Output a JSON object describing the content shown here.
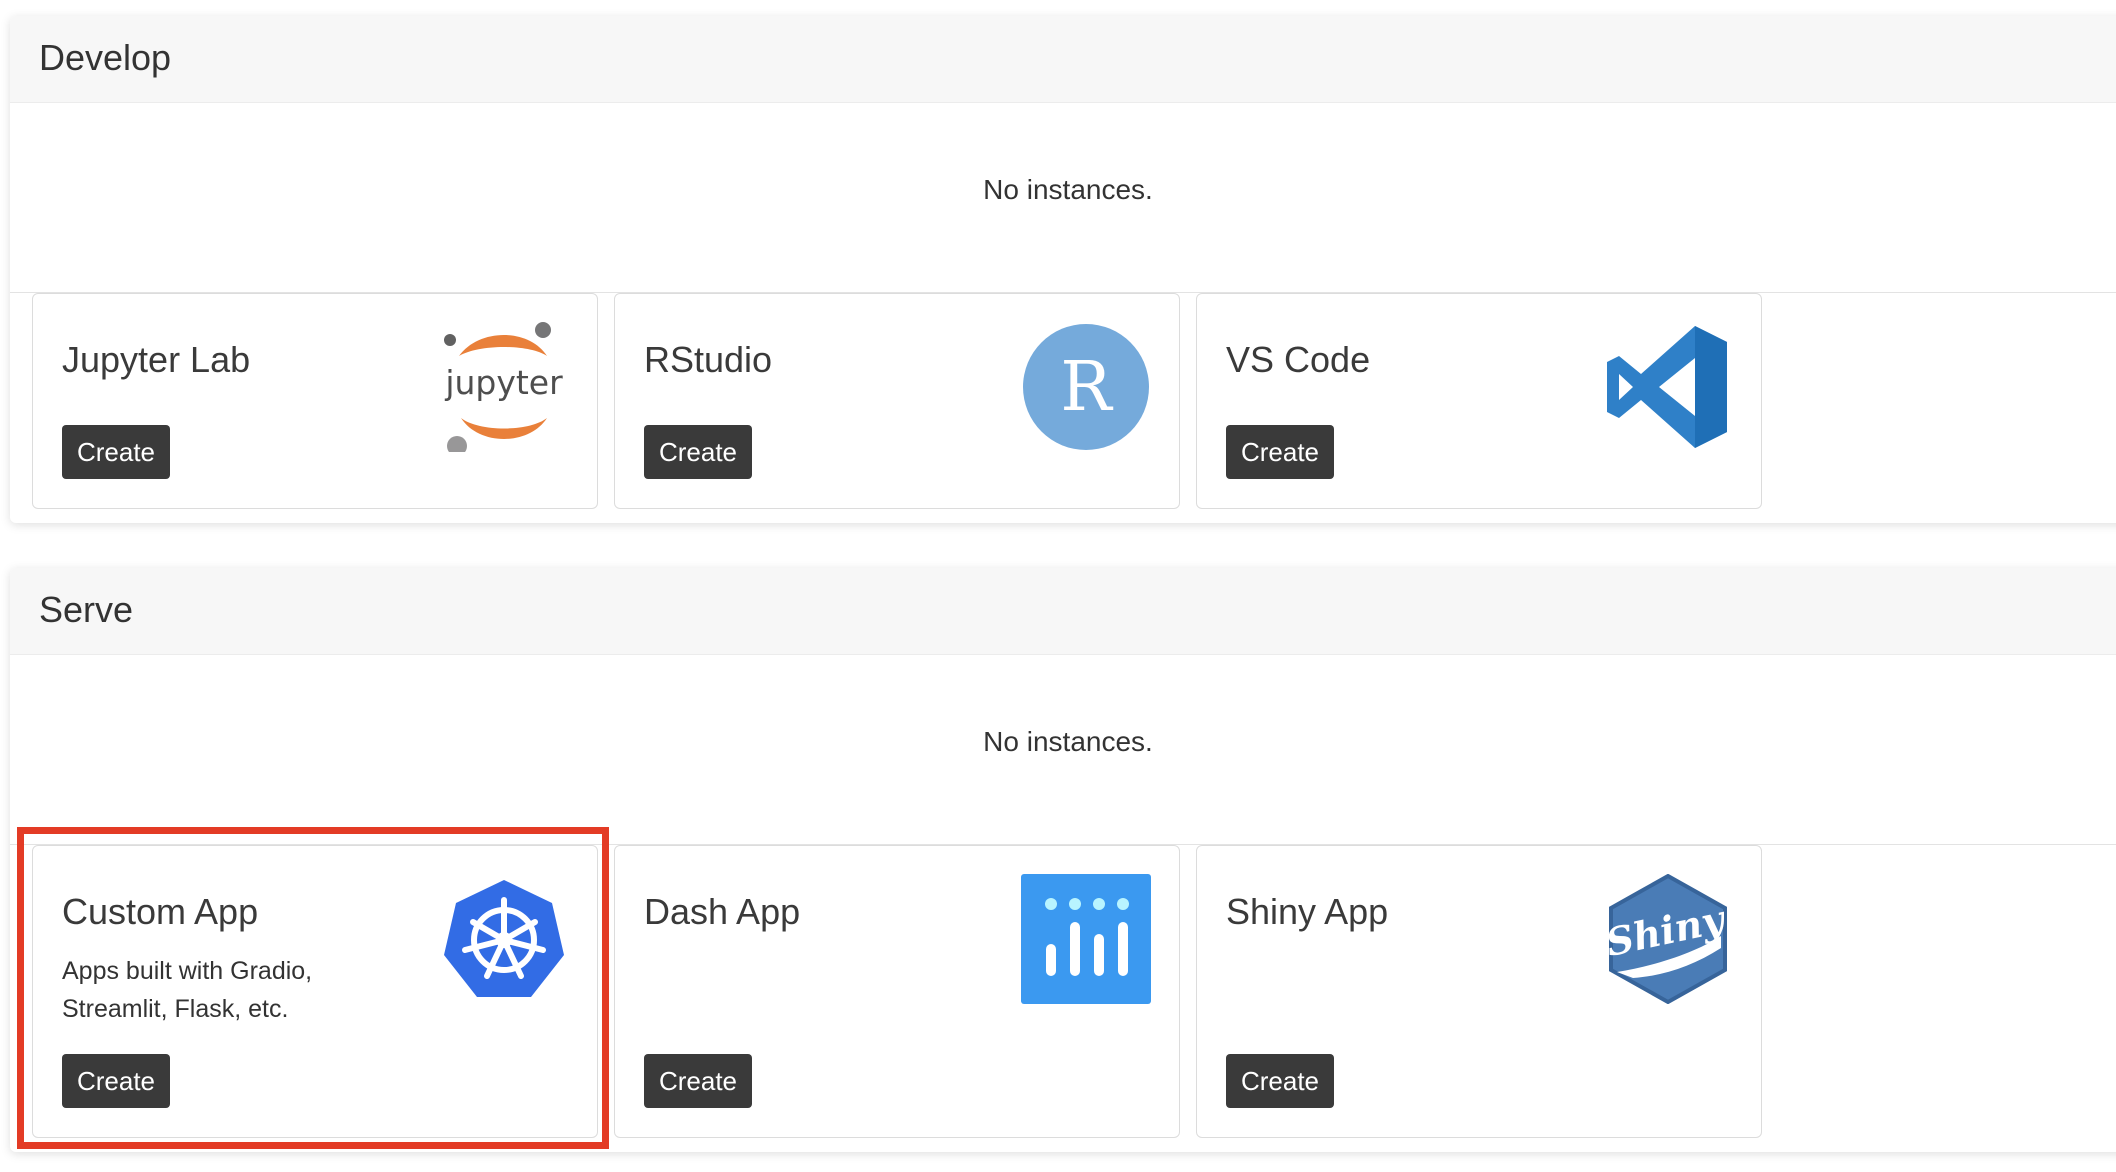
{
  "sections": [
    {
      "title": "Develop",
      "no_instances": "No instances.",
      "cards": [
        {
          "title": "Jupyter Lab",
          "description": "",
          "button": "Create",
          "icon": "jupyter-icon",
          "logo_text": "jupyter"
        },
        {
          "title": "RStudio",
          "description": "",
          "button": "Create",
          "icon": "rstudio-icon",
          "logo_text": "R"
        },
        {
          "title": "VS Code",
          "description": "",
          "button": "Create",
          "icon": "vscode-icon"
        }
      ]
    },
    {
      "title": "Serve",
      "no_instances": "No instances.",
      "cards": [
        {
          "title": "Custom App",
          "description": "Apps built with Gradio, Streamlit, Flask, etc.",
          "button": "Create",
          "icon": "kubernetes-icon"
        },
        {
          "title": "Dash App",
          "description": "",
          "button": "Create",
          "icon": "dash-icon"
        },
        {
          "title": "Shiny App",
          "description": "",
          "button": "Create",
          "icon": "shiny-icon",
          "logo_text": "Shiny"
        }
      ]
    }
  ],
  "highlight": {
    "target": "Custom App",
    "color": "#e33b25"
  },
  "colors": {
    "button_bg": "#3a3a3a",
    "jupyter_orange": "#e9803a",
    "rstudio_blue": "#75aadb",
    "vscode_blue": "#2f80c8",
    "kubernetes_blue": "#326ce5",
    "dash_blue": "#3b99f0",
    "shiny_blue": "#4a7cb6"
  }
}
